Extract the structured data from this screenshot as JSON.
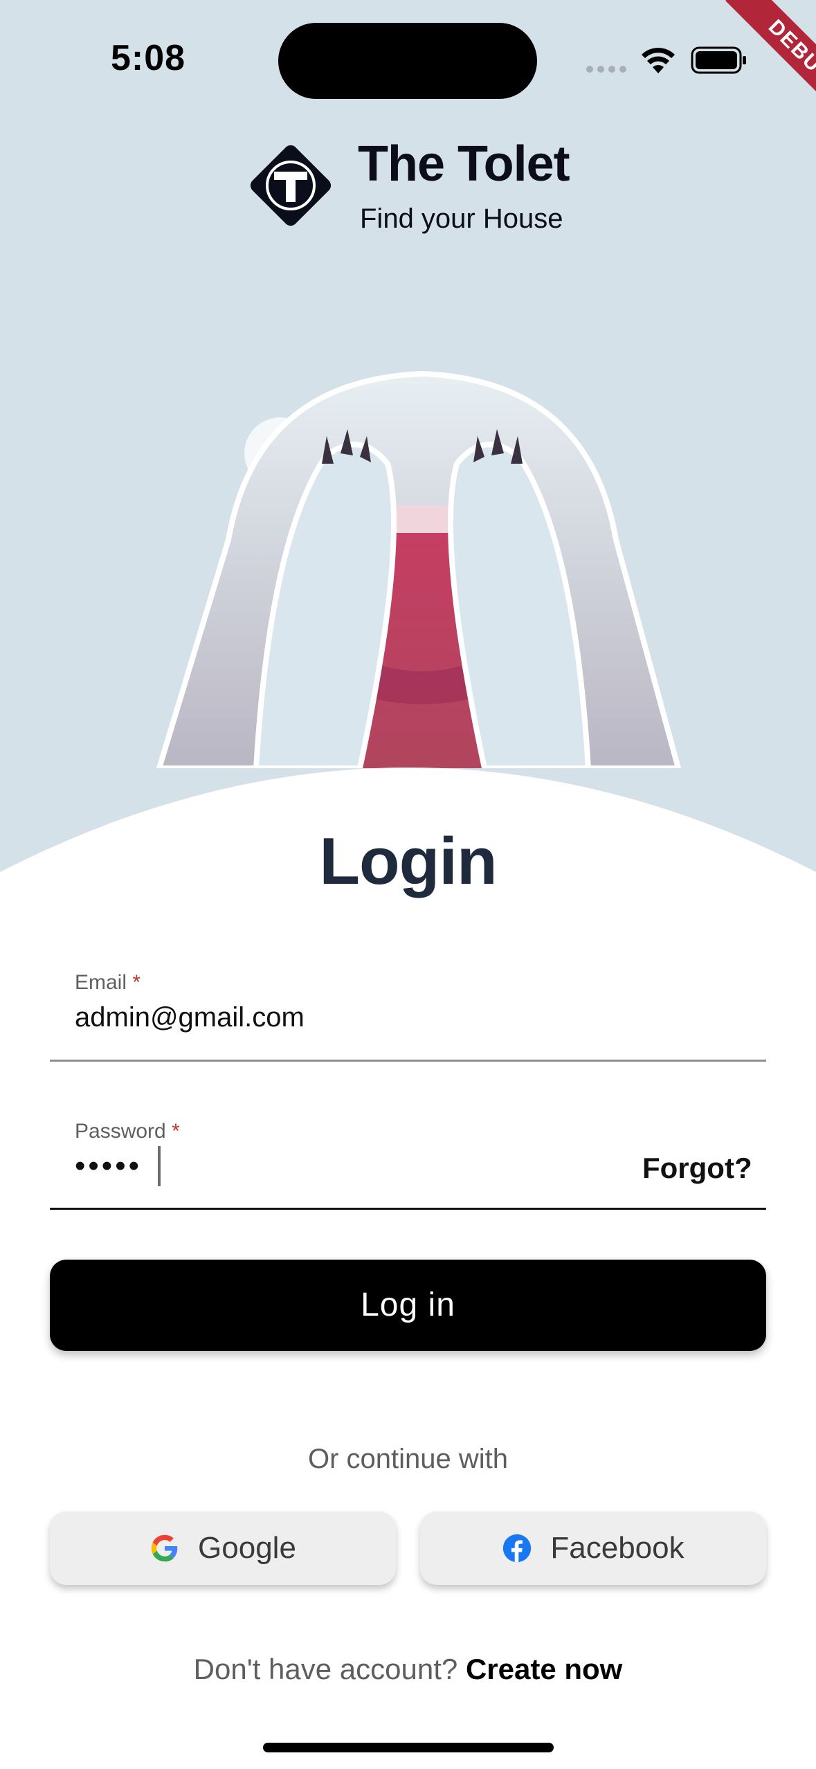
{
  "status_bar": {
    "time": "5:08",
    "debug_label": "DEBUG"
  },
  "header": {
    "app_name": "The Tolet",
    "tagline": "Find your House"
  },
  "login": {
    "title": "Login",
    "email_label": "Email",
    "email_value": "admin@gmail.com",
    "password_label": "Password",
    "password_value": "•••••",
    "required_mark": "*",
    "forgot_label": "Forgot?",
    "submit_label": "Log in"
  },
  "social": {
    "divider_text": "Or continue with",
    "google_label": "Google",
    "facebook_label": "Facebook"
  },
  "footer": {
    "prompt": "Don't have account?",
    "create_label": "Create now"
  },
  "colors": {
    "background": "#d5e1e8",
    "primary_button": "#000000",
    "title": "#1f2a3d",
    "required": "#c0392b",
    "debug_band": "#b2263a"
  }
}
